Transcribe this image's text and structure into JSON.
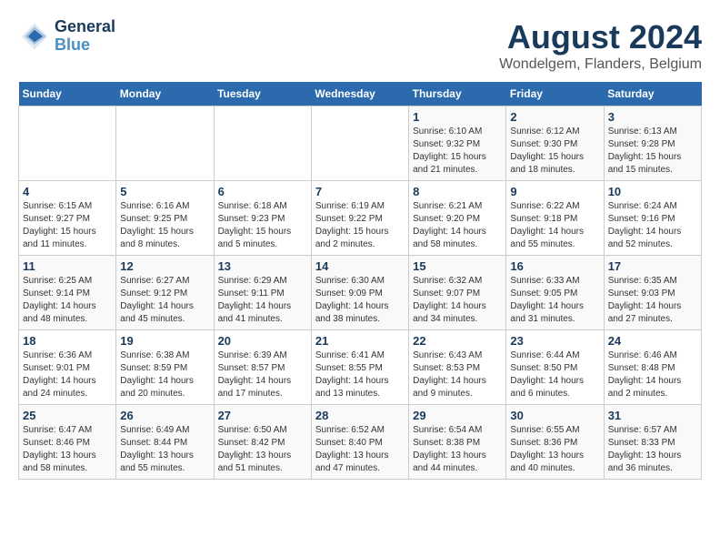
{
  "header": {
    "logo_line1": "General",
    "logo_line2": "Blue",
    "title": "August 2024",
    "subtitle": "Wondelgem, Flanders, Belgium"
  },
  "calendar": {
    "days_of_week": [
      "Sunday",
      "Monday",
      "Tuesday",
      "Wednesday",
      "Thursday",
      "Friday",
      "Saturday"
    ],
    "weeks": [
      [
        {
          "day": "",
          "info": ""
        },
        {
          "day": "",
          "info": ""
        },
        {
          "day": "",
          "info": ""
        },
        {
          "day": "",
          "info": ""
        },
        {
          "day": "1",
          "info": "Sunrise: 6:10 AM\nSunset: 9:32 PM\nDaylight: 15 hours\nand 21 minutes."
        },
        {
          "day": "2",
          "info": "Sunrise: 6:12 AM\nSunset: 9:30 PM\nDaylight: 15 hours\nand 18 minutes."
        },
        {
          "day": "3",
          "info": "Sunrise: 6:13 AM\nSunset: 9:28 PM\nDaylight: 15 hours\nand 15 minutes."
        }
      ],
      [
        {
          "day": "4",
          "info": "Sunrise: 6:15 AM\nSunset: 9:27 PM\nDaylight: 15 hours\nand 11 minutes."
        },
        {
          "day": "5",
          "info": "Sunrise: 6:16 AM\nSunset: 9:25 PM\nDaylight: 15 hours\nand 8 minutes."
        },
        {
          "day": "6",
          "info": "Sunrise: 6:18 AM\nSunset: 9:23 PM\nDaylight: 15 hours\nand 5 minutes."
        },
        {
          "day": "7",
          "info": "Sunrise: 6:19 AM\nSunset: 9:22 PM\nDaylight: 15 hours\nand 2 minutes."
        },
        {
          "day": "8",
          "info": "Sunrise: 6:21 AM\nSunset: 9:20 PM\nDaylight: 14 hours\nand 58 minutes."
        },
        {
          "day": "9",
          "info": "Sunrise: 6:22 AM\nSunset: 9:18 PM\nDaylight: 14 hours\nand 55 minutes."
        },
        {
          "day": "10",
          "info": "Sunrise: 6:24 AM\nSunset: 9:16 PM\nDaylight: 14 hours\nand 52 minutes."
        }
      ],
      [
        {
          "day": "11",
          "info": "Sunrise: 6:25 AM\nSunset: 9:14 PM\nDaylight: 14 hours\nand 48 minutes."
        },
        {
          "day": "12",
          "info": "Sunrise: 6:27 AM\nSunset: 9:12 PM\nDaylight: 14 hours\nand 45 minutes."
        },
        {
          "day": "13",
          "info": "Sunrise: 6:29 AM\nSunset: 9:11 PM\nDaylight: 14 hours\nand 41 minutes."
        },
        {
          "day": "14",
          "info": "Sunrise: 6:30 AM\nSunset: 9:09 PM\nDaylight: 14 hours\nand 38 minutes."
        },
        {
          "day": "15",
          "info": "Sunrise: 6:32 AM\nSunset: 9:07 PM\nDaylight: 14 hours\nand 34 minutes."
        },
        {
          "day": "16",
          "info": "Sunrise: 6:33 AM\nSunset: 9:05 PM\nDaylight: 14 hours\nand 31 minutes."
        },
        {
          "day": "17",
          "info": "Sunrise: 6:35 AM\nSunset: 9:03 PM\nDaylight: 14 hours\nand 27 minutes."
        }
      ],
      [
        {
          "day": "18",
          "info": "Sunrise: 6:36 AM\nSunset: 9:01 PM\nDaylight: 14 hours\nand 24 minutes."
        },
        {
          "day": "19",
          "info": "Sunrise: 6:38 AM\nSunset: 8:59 PM\nDaylight: 14 hours\nand 20 minutes."
        },
        {
          "day": "20",
          "info": "Sunrise: 6:39 AM\nSunset: 8:57 PM\nDaylight: 14 hours\nand 17 minutes."
        },
        {
          "day": "21",
          "info": "Sunrise: 6:41 AM\nSunset: 8:55 PM\nDaylight: 14 hours\nand 13 minutes."
        },
        {
          "day": "22",
          "info": "Sunrise: 6:43 AM\nSunset: 8:53 PM\nDaylight: 14 hours\nand 9 minutes."
        },
        {
          "day": "23",
          "info": "Sunrise: 6:44 AM\nSunset: 8:50 PM\nDaylight: 14 hours\nand 6 minutes."
        },
        {
          "day": "24",
          "info": "Sunrise: 6:46 AM\nSunset: 8:48 PM\nDaylight: 14 hours\nand 2 minutes."
        }
      ],
      [
        {
          "day": "25",
          "info": "Sunrise: 6:47 AM\nSunset: 8:46 PM\nDaylight: 13 hours\nand 58 minutes."
        },
        {
          "day": "26",
          "info": "Sunrise: 6:49 AM\nSunset: 8:44 PM\nDaylight: 13 hours\nand 55 minutes."
        },
        {
          "day": "27",
          "info": "Sunrise: 6:50 AM\nSunset: 8:42 PM\nDaylight: 13 hours\nand 51 minutes."
        },
        {
          "day": "28",
          "info": "Sunrise: 6:52 AM\nSunset: 8:40 PM\nDaylight: 13 hours\nand 47 minutes."
        },
        {
          "day": "29",
          "info": "Sunrise: 6:54 AM\nSunset: 8:38 PM\nDaylight: 13 hours\nand 44 minutes."
        },
        {
          "day": "30",
          "info": "Sunrise: 6:55 AM\nSunset: 8:36 PM\nDaylight: 13 hours\nand 40 minutes."
        },
        {
          "day": "31",
          "info": "Sunrise: 6:57 AM\nSunset: 8:33 PM\nDaylight: 13 hours\nand 36 minutes."
        }
      ]
    ]
  }
}
